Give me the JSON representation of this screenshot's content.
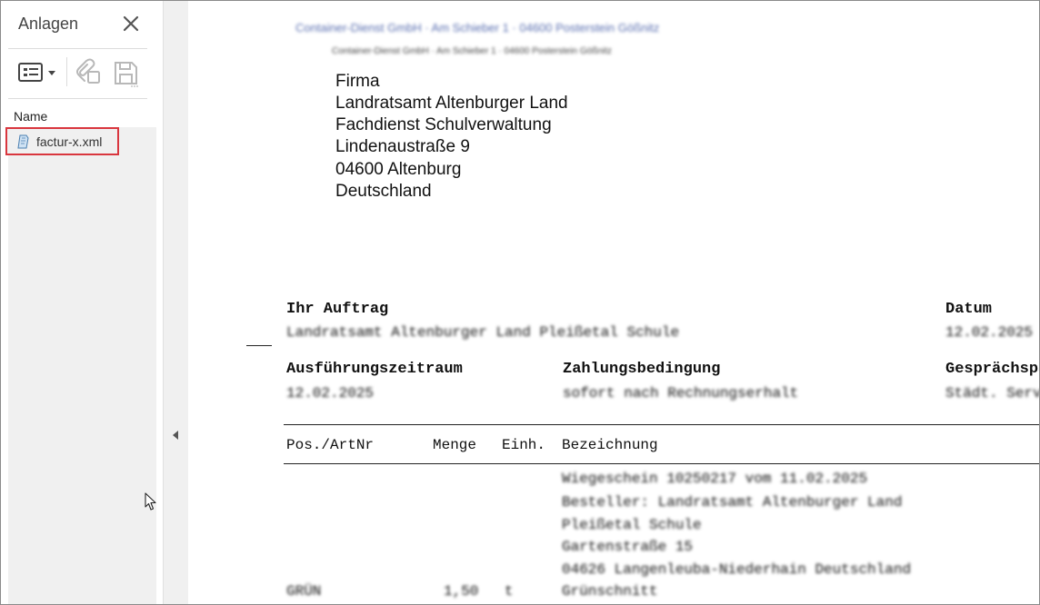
{
  "sidebar": {
    "title": "Anlagen",
    "column_header": "Name",
    "file": {
      "name": "factur-x.xml"
    }
  },
  "document": {
    "sender_line_1": "Container-Dienst GmbH · Am Schieber 1 · 04600 Posterstein Gößnitz",
    "sender_line_2": "Container-Dienst GmbH · Am Schieber 1 · 04600 Posterstein Gößnitz",
    "address": [
      "Firma",
      "Landratsamt Altenburger Land",
      "Fachdienst Schulverwaltung",
      "Lindenaustraße 9",
      "04600  Altenburg",
      "Deutschland"
    ],
    "order_label": "Ihr Auftrag",
    "order_value": "Landratsamt Altenburger Land Pleißetal Schule",
    "date_label": "Datum",
    "date_value": "12.02.2025",
    "period_label": "Ausführungszeitraum",
    "period_value": "12.02.2025",
    "payment_label": "Zahlungsbedingung",
    "payment_value": "sofort nach Rechnungserhalt",
    "contact_label": "Gesprächspartner",
    "contact_value": "Städt. Service",
    "table_headers": [
      "Pos./ArtNr",
      "Menge",
      "Einh.",
      "Bezeichnung"
    ],
    "item_lines": [
      "Wiegeschein 10250217 vom 11.02.2025",
      "Besteller: Landratsamt Altenburger Land",
      "Pleißetal Schule",
      "Gartenstraße 15",
      "04626 Langenleuba-Niederhain Deutschland",
      "Grünschnitt"
    ],
    "item_pos": "GRÜN",
    "item_qty": "1,50",
    "item_unit": "t"
  }
}
